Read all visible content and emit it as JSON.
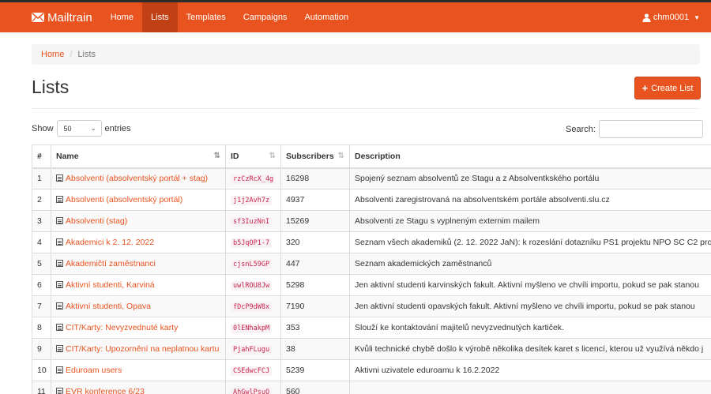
{
  "app": {
    "brand": "Mailtrain"
  },
  "nav": {
    "items": [
      {
        "label": "Home",
        "active": false
      },
      {
        "label": "Lists",
        "active": true
      },
      {
        "label": "Templates",
        "active": false
      },
      {
        "label": "Campaigns",
        "active": false
      },
      {
        "label": "Automation",
        "active": false
      }
    ],
    "user": "chm0001"
  },
  "breadcrumb": {
    "home": "Home",
    "separator": "/",
    "current": "Lists"
  },
  "page": {
    "title": "Lists",
    "create_label": "Create List"
  },
  "controls": {
    "show_label": "Show",
    "show_value": "50",
    "entries_label": "entries",
    "search_label": "Search:",
    "search_value": ""
  },
  "table": {
    "columns": [
      "#",
      "Name",
      "ID",
      "Subscribers",
      "Description"
    ],
    "rows": [
      {
        "n": "1",
        "name": "Absolventi (absolventský portál + stag)",
        "id": "rzCzRcX_4g",
        "subs": "16298",
        "desc": "Spojený seznam absolventů ze Stagu a z Absolventkského portálu"
      },
      {
        "n": "2",
        "name": "Absolventi (absolventský portál)",
        "id": "j1j2Avh7z",
        "subs": "4937",
        "desc": "Absolventi zaregistrovaná na absolventském portále absolventi.slu.cz"
      },
      {
        "n": "3",
        "name": "Absolventi (stag)",
        "id": "sf3IuzNnI",
        "subs": "15269",
        "desc": "Absolventi ze Stagu s vyplneným externim mailem"
      },
      {
        "n": "4",
        "name": "Akademici k 2. 12. 2022",
        "id": "b5JqOP1-7",
        "subs": "320",
        "desc": "Seznam všech akademiků (2. 12. 2022 JaN): k rozeslání dotazníku PS1 projektu NPO SC C2 pro"
      },
      {
        "n": "5",
        "name": "Akademičtí zaměstnanci",
        "id": "cjsnL59GP",
        "subs": "447",
        "desc": "Seznam akademických zaměstnanců"
      },
      {
        "n": "6",
        "name": "Aktivní studenti, Karviná",
        "id": "uwlROU8Jw",
        "subs": "5298",
        "desc": "Jen aktivní studenti karvinských fakult. Aktivní myšleno ve chvíli importu, pokud se pak stanou"
      },
      {
        "n": "7",
        "name": "Aktivní studenti, Opava",
        "id": "fDcP9dW8x",
        "subs": "7190",
        "desc": "Jen aktivní studenti opavských fakult. Aktivní myšleno ve chvíli importu, pokud se pak stanou"
      },
      {
        "n": "8",
        "name": "CIT/Karty: Nevyzvednuté karty",
        "id": "0lENhakpM",
        "subs": "353",
        "desc": "Slouží ke kontaktování majitelů nevyzvednutých kartiček."
      },
      {
        "n": "9",
        "name": "CIT/Karty: Upozornění na neplatnou kartu",
        "id": "PjahFLugu",
        "subs": "38",
        "desc": "Kvůli technické chybě došlo k výrobě několika desítek karet s licencí, kterou už využívá někdo j"
      },
      {
        "n": "10",
        "name": "Eduroam users",
        "id": "CSEdwcFCJ",
        "subs": "5239",
        "desc": "Aktivni uzivatele eduroamu k 16.2.2022"
      },
      {
        "n": "11",
        "name": "EVR konference 6/23",
        "id": "AhGwlPsuQ",
        "subs": "560",
        "desc": ""
      }
    ]
  }
}
